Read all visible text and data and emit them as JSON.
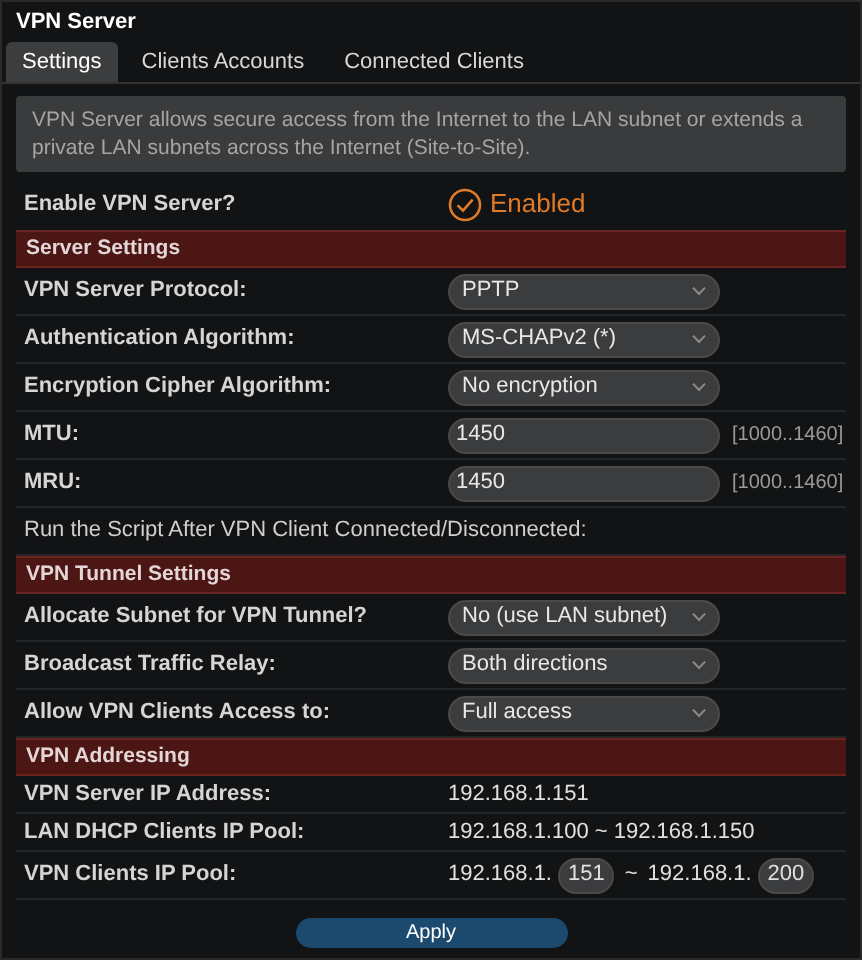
{
  "title": "VPN Server",
  "tabs": [
    {
      "label": "Settings",
      "selected": true
    },
    {
      "label": "Clients Accounts",
      "selected": false
    },
    {
      "label": "Connected Clients",
      "selected": false
    }
  ],
  "info": "VPN Server allows secure access from the Internet to the LAN subnet or extends a private LAN subnets across the Internet (Site-to-Site).",
  "enable": {
    "label": "Enable VPN Server?",
    "on": true,
    "text": "Enabled"
  },
  "sections": [
    {
      "title": "Server Settings",
      "rows": [
        {
          "kind": "select",
          "label": "VPN Server Protocol:",
          "value": "PPTP"
        },
        {
          "kind": "select",
          "label": "Authentication Algorithm:",
          "value": "MS-CHAPv2 (*)"
        },
        {
          "kind": "select",
          "label": "Encryption Cipher Algorithm:",
          "value": "No encryption"
        },
        {
          "kind": "input",
          "label": "MTU:",
          "value": "1450",
          "hint": "[1000..1460]"
        },
        {
          "kind": "input",
          "label": "MRU:",
          "value": "1450",
          "hint": "[1000..1460]"
        },
        {
          "kind": "note",
          "label": "Run the Script After VPN Client Connected/Disconnected:"
        }
      ]
    },
    {
      "title": "VPN Tunnel Settings",
      "rows": [
        {
          "kind": "select",
          "label": "Allocate Subnet for VPN Tunnel?",
          "value": "No (use LAN subnet)"
        },
        {
          "kind": "select",
          "label": "Broadcast Traffic Relay:",
          "value": "Both directions"
        },
        {
          "kind": "select",
          "label": "Allow VPN Clients Access to:",
          "value": "Full access"
        }
      ]
    },
    {
      "title": "VPN Addressing",
      "rows": [
        {
          "kind": "text",
          "label": "VPN Server IP Address:",
          "value": "192.168.1.151"
        },
        {
          "kind": "text",
          "label": "LAN DHCP Clients IP Pool:",
          "value": "192.168.1.100 ~ 192.168.1.150"
        },
        {
          "kind": "pool",
          "label": "VPN Clients IP Pool:",
          "prefix_start": "192.168.1.",
          "start": "151",
          "separator": "~",
          "prefix_end": "192.168.1.",
          "end": "200"
        }
      ]
    }
  ],
  "apply": "Apply"
}
